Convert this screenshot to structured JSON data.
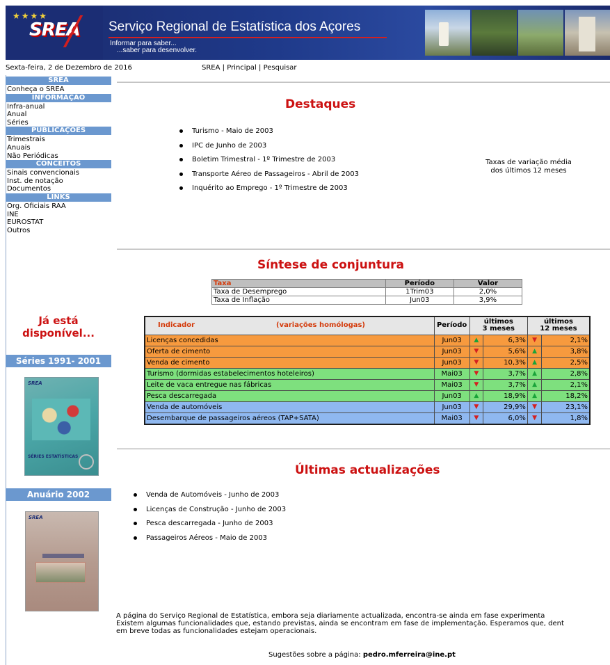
{
  "header": {
    "logo_text": "SREA",
    "site_title": "Serviço Regional de Estatística dos Açores",
    "tagline_1": "Informar para saber...",
    "tagline_2": "...saber para desenvolver."
  },
  "date": "Sexta-feira, 2 de Dezembro de 2016",
  "top_nav": {
    "srea": "SREA",
    "principal": "Principal",
    "pesquisar": "Pesquisar",
    "separator": "|"
  },
  "sidebar": {
    "sections": [
      {
        "title": "SREA",
        "items": [
          "Conheça o SREA"
        ]
      },
      {
        "title": "INFORMAÇÃO",
        "items": [
          "Infra-anual",
          "Anual",
          "Séries"
        ]
      },
      {
        "title": "PUBLICAÇÕES",
        "items": [
          "Trimestrais",
          "Anuais",
          "Não Periódicas"
        ]
      },
      {
        "title": "CONCEITOS",
        "items": [
          "Sinais convencionais",
          "Inst. de notação",
          "Documentos"
        ]
      },
      {
        "title": "LINKS",
        "items": [
          "Org. Oficiais RAA",
          "INE",
          "EUROSTAT",
          "Outros"
        ]
      }
    ],
    "promo_title_1": "Já está",
    "promo_title_2": "disponível...",
    "series_label": "Séries 1991- 2001",
    "book1_logo": "SREA",
    "book1_label": "SÉRIES ESTATÍSTICAS",
    "anuario_label": "Anuário 2002",
    "book2_logo": "SREA"
  },
  "destaques": {
    "title": "Destaques",
    "items": [
      "Turismo - Maio de 2003",
      "IPC de Junho de 2003",
      "Boletim Trimestral - 1º Trimestre de 2003",
      "Transporte Aéreo de Passageiros - Abril de 2003",
      "Inquérito ao Emprego - 1º Trimestre de 2003"
    ],
    "note_1": "Taxas de variação média",
    "note_2": "dos últimos 12 meses"
  },
  "sintese": {
    "title": "Síntese de conjuntura",
    "taxa_headers": {
      "taxa": "Taxa",
      "periodo": "Período",
      "valor": "Valor"
    },
    "taxa_rows": [
      {
        "name": "Taxa de Desemprego",
        "periodo": "1Trim03",
        "valor": "2,0%"
      },
      {
        "name": "Taxa de Inflação",
        "periodo": "Jun03",
        "valor": "3,9%"
      }
    ],
    "ind_headers": {
      "indicador": "Indicador",
      "variacoes": "(variações homólogas)",
      "periodo": "Período",
      "ultimos3_a": "últimos",
      "ultimos3_b": "3 meses",
      "ultimos12_a": "últimos",
      "ultimos12_b": "12 meses"
    },
    "ind_rows": [
      {
        "name": "Licenças concedidas",
        "periodo": "Jun03",
        "dir3": "up",
        "v3": "6,3%",
        "dir12": "down",
        "v12": "2,1%",
        "color": "orange"
      },
      {
        "name": "Oferta de cimento",
        "periodo": "Jun03",
        "dir3": "down",
        "v3": "5,6%",
        "dir12": "up",
        "v12": "3,8%",
        "color": "orange"
      },
      {
        "name": "Venda de cimento",
        "periodo": "Jun03",
        "dir3": "down",
        "v3": "10,3%",
        "dir12": "up",
        "v12": "2,5%",
        "color": "orange"
      },
      {
        "name": "Turismo (dormidas estabelecimentos hoteleiros)",
        "periodo": "Mai03",
        "dir3": "down",
        "v3": "3,7%",
        "dir12": "up",
        "v12": "2,8%",
        "color": "green"
      },
      {
        "name": "Leite de vaca entregue nas fábricas",
        "periodo": "Mai03",
        "dir3": "down",
        "v3": "3,7%",
        "dir12": "up",
        "v12": "2,1%",
        "color": "green"
      },
      {
        "name": "Pesca descarregada",
        "periodo": "Jun03",
        "dir3": "up",
        "v3": "18,9%",
        "dir12": "up",
        "v12": "18,2%",
        "color": "green"
      },
      {
        "name": "Venda de automóveis",
        "periodo": "Jun03",
        "dir3": "down",
        "v3": "29,9%",
        "dir12": "down",
        "v12": "23,1%",
        "color": "blue"
      },
      {
        "name": "Desembarque de passageiros aéreos (TAP+SATA)",
        "periodo": "Mai03",
        "dir3": "down",
        "v3": "6,0%",
        "dir12": "down",
        "v12": "1,8%",
        "color": "blue"
      }
    ]
  },
  "actualizacoes": {
    "title": "Últimas actualizações",
    "items": [
      "Venda de Automóveis - Junho de 2003",
      "Licenças de Construção - Junho de 2003",
      "Pesca descarregada - Junho de 2003",
      "Passageiros Aéreos - Maio de 2003"
    ]
  },
  "footer": {
    "line1": "A página do Serviço Regional de Estatística, embora seja diariamente actualizada, encontra-se ainda em fase experimenta",
    "line2": "Existem algumas funcionalidades que, estando previstas, ainda se encontram em fase de implementação. Esperamos que, dent",
    "line3": "em breve todas as funcionalidades estejam operacionais.",
    "suggest_label": "Sugestões sobre a página:",
    "email": "pedro.mferreira@ine.pt"
  },
  "colors": {
    "accent_red": "#cc1111",
    "sidebar_head": "#6b98cf",
    "row_orange": "#f79a3e",
    "row_green": "#7ee07e",
    "row_blue": "#8fb8f0",
    "arrow_up": "#1aa33a",
    "arrow_down": "#d42020"
  },
  "icons": {
    "arrow_up": "up-triangle-icon",
    "arrow_down": "down-triangle-icon",
    "bullet": "bullet-icon"
  }
}
